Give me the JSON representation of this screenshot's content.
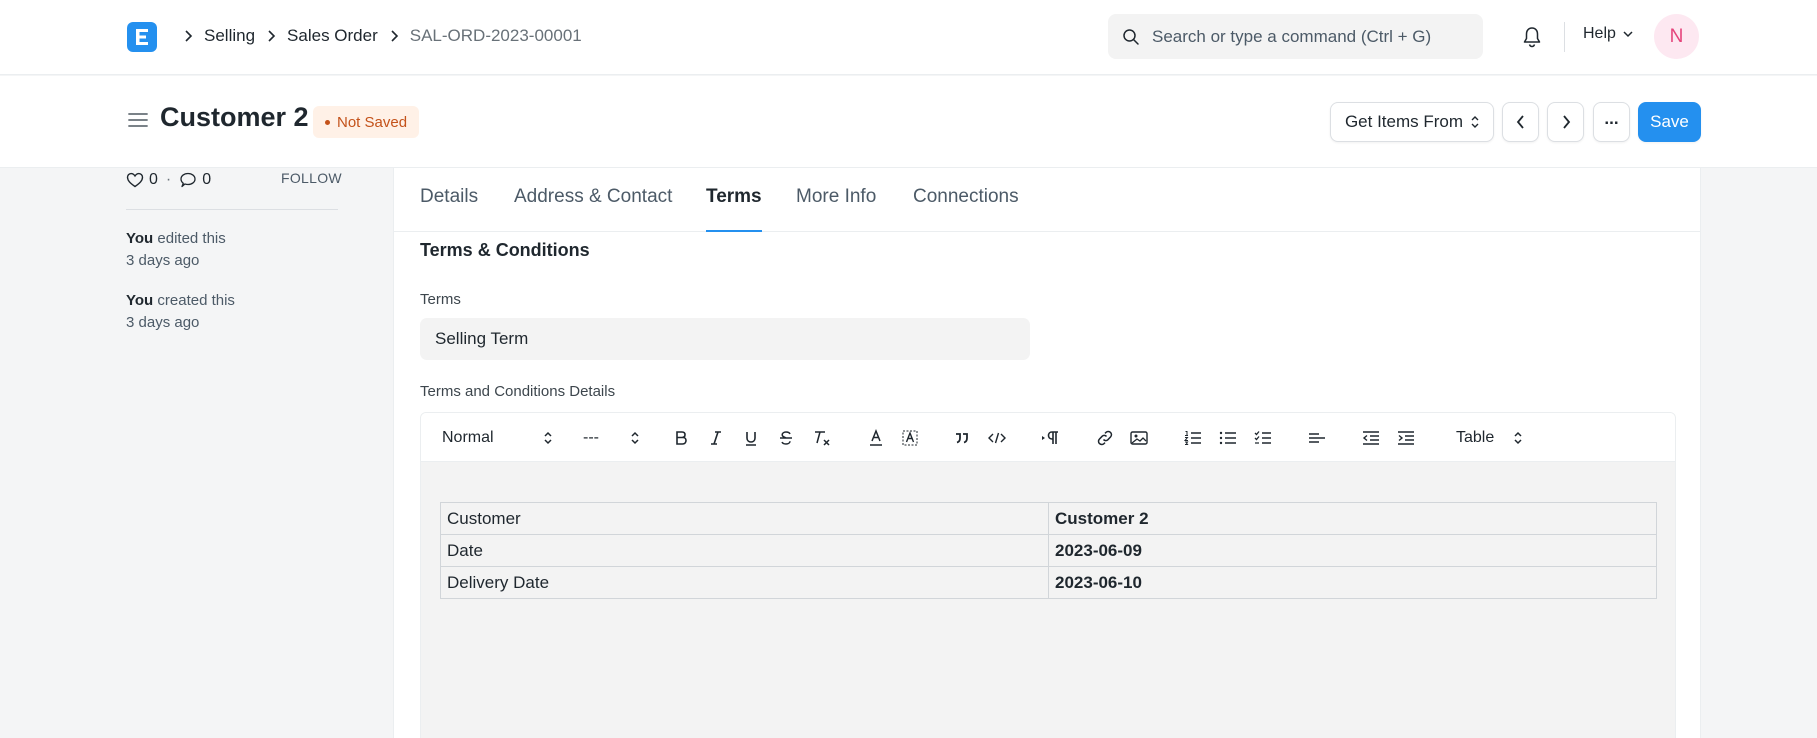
{
  "navbar": {
    "breadcrumbs": [
      "Selling",
      "Sales Order",
      "SAL-ORD-2023-00001"
    ],
    "search_placeholder": "Search or type a command (Ctrl + G)",
    "help_label": "Help",
    "avatar_initial": "N",
    "accent": "#2490ef"
  },
  "page": {
    "title": "Customer 2",
    "status_badge": "Not Saved",
    "get_items_label": "Get Items From",
    "more_label": "...",
    "save_label": "Save"
  },
  "sidebar": {
    "likes": "0",
    "comments": "0",
    "follow_label": "FOLLOW",
    "activity": [
      {
        "who": "You",
        "action": "edited this",
        "when": "3 days ago"
      },
      {
        "who": "You",
        "action": "created this",
        "when": "3 days ago"
      }
    ]
  },
  "tabs": [
    {
      "label": "Details",
      "active": false
    },
    {
      "label": "Address & Contact",
      "active": false
    },
    {
      "label": "Terms",
      "active": true
    },
    {
      "label": "More Info",
      "active": false
    },
    {
      "label": "Connections",
      "active": false
    }
  ],
  "form": {
    "section_title": "Terms & Conditions",
    "terms_label": "Terms",
    "terms_value": "Selling Term",
    "details_label": "Terms and Conditions Details"
  },
  "editor": {
    "text_style": "Normal",
    "font_size": "---",
    "table_label": "Table",
    "table_rows": [
      [
        "Customer",
        "Customer 2"
      ],
      [
        "Date",
        "2023-06-09"
      ],
      [
        "Delivery Date",
        "2023-06-10"
      ]
    ]
  }
}
